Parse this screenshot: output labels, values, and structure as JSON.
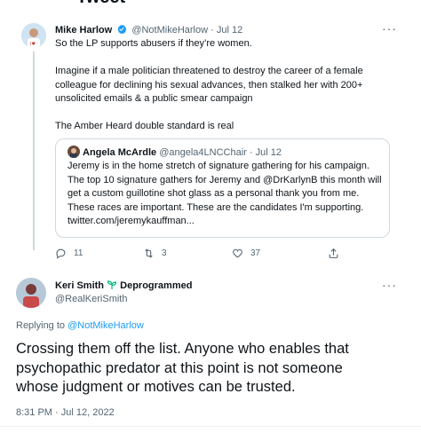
{
  "header": {
    "title": "Tweet"
  },
  "tweet1": {
    "author_name": "Mike Harlow",
    "handle": "@NotMikeHarlow",
    "dot": "·",
    "date": "Jul 12",
    "lines": [
      "So the LP supports abusers if they’re women.",
      "Imagine if a male politician threatened to destroy the career of a female",
      "colleague for declining his sexual advances, then stalked her with 200+",
      "unsolicited emails & a public smear campaign",
      "The Amber Heard double standard is real"
    ],
    "more": "···",
    "quote": {
      "author_name": "Angela McArdle",
      "handle": "@angela4LNCChair",
      "dot": "·",
      "date": "Jul 12",
      "lines": [
        "Jeremy is in the home stretch of signature gathering for his campaign.",
        "The top 10 signature gathers for Jeremy and @DrKarlynB this month will",
        "get a custom guillotine shot glass as a personal thank you from me.",
        "These races are important. These are the candidates I'm supporting.",
        "twitter.com/jeremykauffman..."
      ]
    },
    "actions": {
      "replies": "11",
      "retweets": "3",
      "likes": "37"
    }
  },
  "tweet2": {
    "author_name": "Keri Smith",
    "badge_text": "Deprogrammed",
    "handle": "@RealKeriSmith",
    "more": "···",
    "replying_prefix": "Replying to",
    "replying_handle": "@NotMikeHarlow",
    "lines": [
      "Crossing them off the list. Anyone who enables that",
      "psychopathic predator at this point is not someone",
      "whose judgment or motives can be trusted."
    ],
    "timestamp": "8:31 PM · Jul 12, 2022"
  },
  "colors": {
    "accent": "#1d9bf0",
    "muted": "#536471",
    "text": "#0f1419",
    "border": "#cfd9de",
    "badge_green": "#00ba7c"
  }
}
